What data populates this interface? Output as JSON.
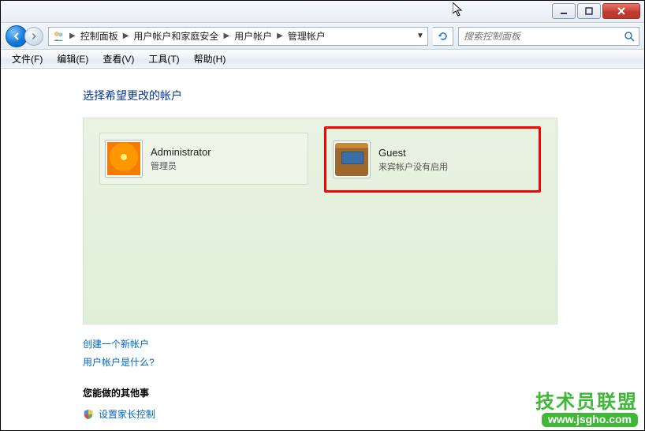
{
  "titlebar": {
    "minimize": "min",
    "maximize": "max",
    "close": "close"
  },
  "nav": {
    "back": "back",
    "forward": "forward"
  },
  "breadcrumb": {
    "items": [
      "控制面板",
      "用户帐户和家庭安全",
      "用户帐户",
      "管理帐户"
    ]
  },
  "search": {
    "placeholder": "搜索控制面板"
  },
  "menubar": {
    "file": "文件(F)",
    "edit": "编辑(E)",
    "view": "查看(V)",
    "tools": "工具(T)",
    "help": "帮助(H)"
  },
  "heading": "选择希望更改的帐户",
  "accounts": [
    {
      "name": "Administrator",
      "sub": "管理员"
    },
    {
      "name": "Guest",
      "sub": "来宾帐户没有启用"
    }
  ],
  "links": {
    "create": "创建一个新帐户",
    "whatis": "用户帐户是什么?"
  },
  "section_title": "您能做的其他事",
  "parental": "设置家长控制",
  "watermark": {
    "line1": "技术员联盟",
    "line2": "www.jsgho.com"
  }
}
